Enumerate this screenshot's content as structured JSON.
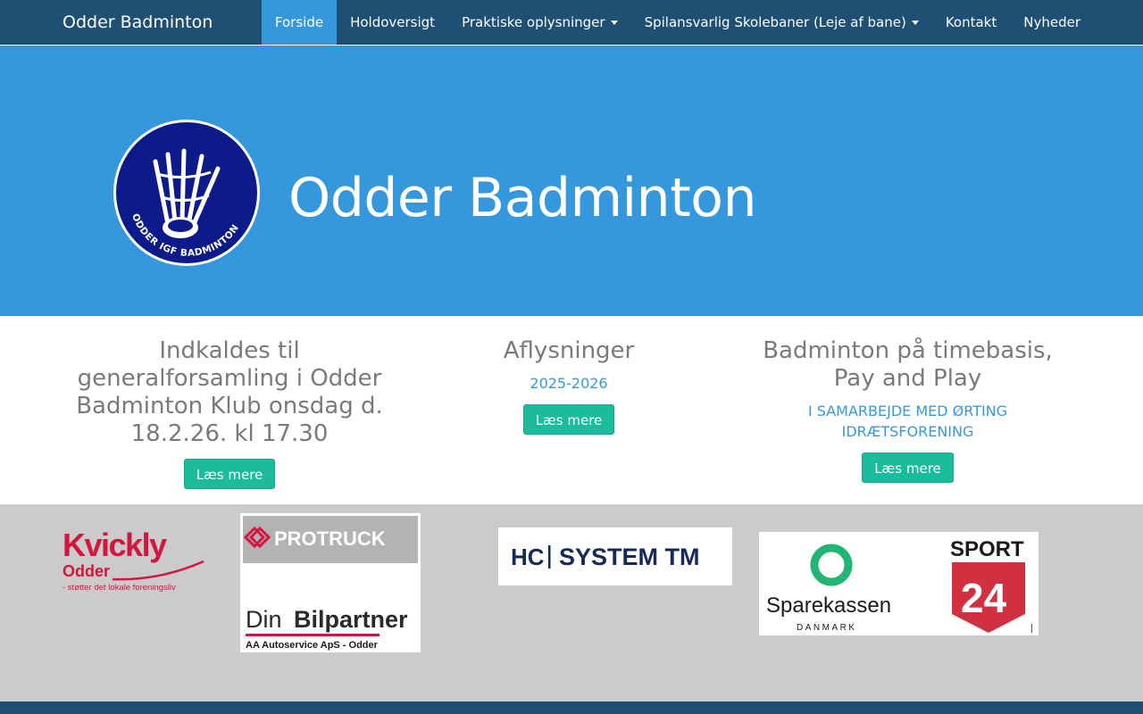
{
  "nav": {
    "brand": "Odder Badminton",
    "items": [
      {
        "label": "Forside",
        "active": true,
        "dropdown": false
      },
      {
        "label": "Holdoversigt",
        "active": false,
        "dropdown": false
      },
      {
        "label": "Praktiske oplysninger",
        "active": false,
        "dropdown": true
      },
      {
        "label": "Spilansvarlig Skolebaner (Leje af bane)",
        "active": false,
        "dropdown": true
      },
      {
        "label": "Kontakt",
        "active": false,
        "dropdown": false
      },
      {
        "label": "Nyheder",
        "active": false,
        "dropdown": false
      }
    ]
  },
  "hero": {
    "title": "Odder Badminton",
    "logo_text": "ODDER IGF BADMINTON"
  },
  "news": [
    {
      "title": "Indkaldes til generalforsamling i Odder Badminton Klub onsdag d. 18.2.26. kl 17.30",
      "subtitle": "",
      "button": "Læs mere"
    },
    {
      "title": "Aflysninger",
      "subtitle": "2025-2026",
      "button": "Læs mere"
    },
    {
      "title": "Badminton på timebasis, Pay and Play",
      "subtitle": "I SAMARBEJDE MED ØRTING IDRÆTSFORENING",
      "button": "Læs mere"
    }
  ],
  "sponsors": {
    "kvickly": {
      "name": "Kvickly",
      "town": "Odder",
      "tagline": "- støtter det lokale foreningsliv"
    },
    "protruck": {
      "name": "PROTRUCK",
      "din": "Din",
      "bilpartner": "Bilpartner",
      "sub": "AA Autoservice ApS - Odder"
    },
    "system": {
      "name": "SYSTEM TM",
      "mark": "HC"
    },
    "sparekassen": {
      "name": "Sparekassen",
      "sub": "DANMARK"
    },
    "sport24": {
      "name": "SPORT",
      "num": "24"
    }
  },
  "colors": {
    "navbar": "#1f4f72",
    "hero": "#3598dc",
    "button": "#1abc9c",
    "sponsor_bg": "#cbcbcb",
    "kvickly_red": "#d2163f"
  }
}
